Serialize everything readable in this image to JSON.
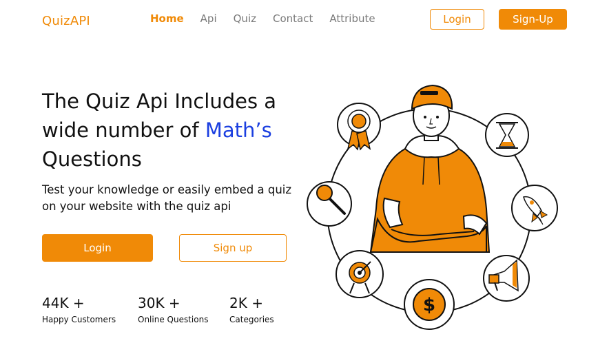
{
  "header": {
    "logo": "QuizAPI",
    "nav": [
      {
        "label": "Home",
        "active": true
      },
      {
        "label": "Api",
        "active": false
      },
      {
        "label": "Quiz",
        "active": false
      },
      {
        "label": "Contact",
        "active": false
      },
      {
        "label": "Attribute",
        "active": false
      }
    ],
    "login_label": "Login",
    "signup_label": "Sign-Up"
  },
  "hero": {
    "title_part1": "The Quiz Api Includes a wide number of ",
    "title_highlight": "Math’s",
    "title_part2": "Questions",
    "subtitle": "Test your knowledge or easily embed a quiz on your website with the quiz api",
    "login_label": "Login",
    "signup_label": "Sign up"
  },
  "stats": [
    {
      "value": "44K +",
      "label": "Happy Customers"
    },
    {
      "value": "30K +",
      "label": "Online Questions"
    },
    {
      "value": "2K +",
      "label": "Categories"
    }
  ],
  "illustration": {
    "icons": [
      "medal-icon",
      "hourglass-icon",
      "magnifier-icon",
      "rocket-icon",
      "target-icon",
      "megaphone-icon",
      "dollar-icon"
    ]
  },
  "colors": {
    "accent": "#F08A07",
    "highlight": "#1B3FE0",
    "text": "#111111",
    "nav_inactive": "#7a7a7a"
  }
}
